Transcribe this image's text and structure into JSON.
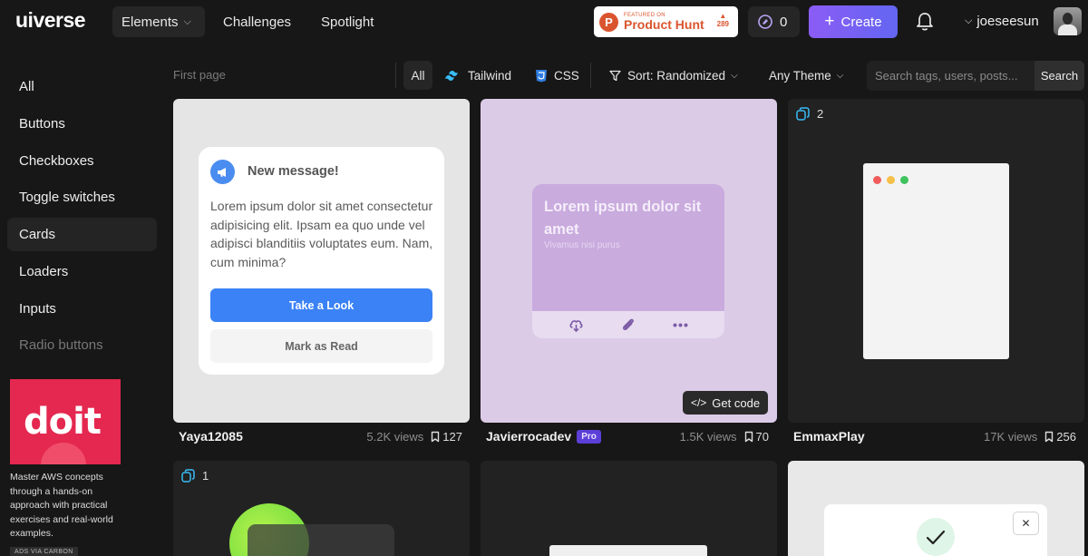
{
  "brand": {
    "logo": "uiverse"
  },
  "nav": {
    "elements": "Elements",
    "challenges": "Challenges",
    "spotlight": "Spotlight"
  },
  "product_hunt": {
    "featured": "FEATURED ON",
    "name": "Product Hunt",
    "count": "289"
  },
  "coins": "0",
  "create_label": "Create",
  "user": {
    "name": "joeseesun"
  },
  "sidebar": {
    "items": [
      {
        "label": "All"
      },
      {
        "label": "Buttons"
      },
      {
        "label": "Checkboxes"
      },
      {
        "label": "Toggle switches"
      },
      {
        "label": "Cards"
      },
      {
        "label": "Loaders"
      },
      {
        "label": "Inputs"
      },
      {
        "label": "Radio buttons"
      }
    ],
    "active": "Cards"
  },
  "ad": {
    "word": "doit",
    "text": "Master AWS concepts through a hands-on approach with practical exercises and real-world examples.",
    "via": "ADS VIA CARBON"
  },
  "filters": {
    "pager": "First page",
    "all": "All",
    "tailwind": "Tailwind",
    "css": "CSS",
    "sort": "Sort: Randomized",
    "theme": "Any Theme",
    "search_placeholder": "Search tags, users, posts...",
    "search_button": "Search"
  },
  "cards": [
    {
      "author": "Yaya12085",
      "views": "5.2K views",
      "saves": "127",
      "preview": {
        "title": "New message!",
        "body": "Lorem ipsum dolor sit amet consectetur adipisicing elit. Ipsam ea quo unde vel adipisci blanditiis voluptates eum. Nam, cum minima?",
        "primary": "Take a Look",
        "secondary": "Mark as Read"
      }
    },
    {
      "author": "Javierrocadev",
      "badge": "Pro",
      "views": "1.5K views",
      "saves": "70",
      "preview": {
        "title": "Lorem ipsum dolor sit amet",
        "subtitle": "Vivamus nisi purus"
      },
      "get_code": "Get code"
    },
    {
      "author": "EmmaxPlay",
      "views": "17K views",
      "saves": "256",
      "variants": "2"
    },
    {
      "variants": "1"
    }
  ],
  "colors": {
    "accent": "#8b5cf6",
    "create_end": "#6366f1",
    "pro_badge": "#5b3fd8",
    "primary_button": "#3b82f6"
  }
}
